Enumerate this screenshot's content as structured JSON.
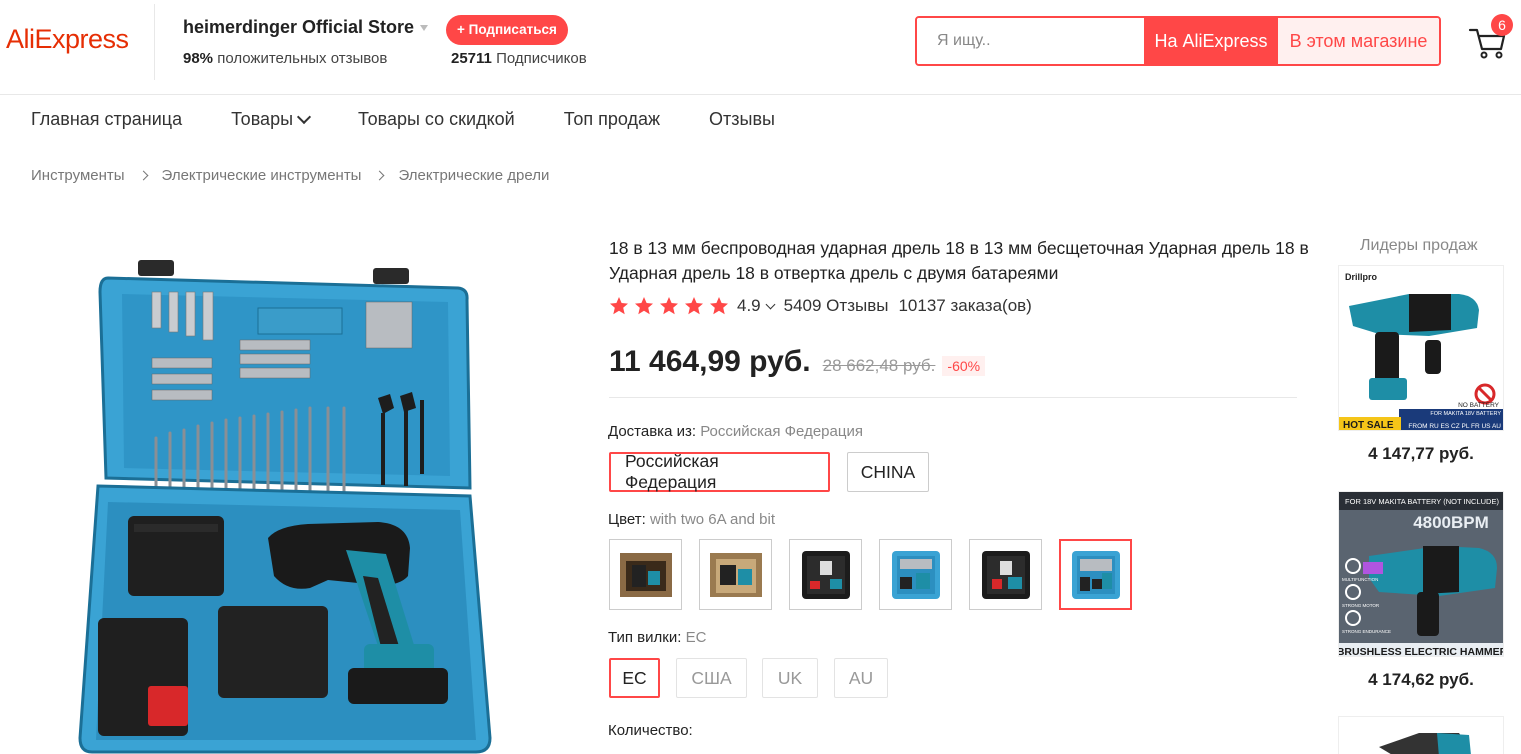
{
  "header": {
    "logo": "AliExpress",
    "store_name": "heimerdinger Official Store",
    "positive_pct": "98%",
    "positive_text": "положительных отзывов",
    "subscribe_label": "+ Подписаться",
    "followers_count": "25711",
    "followers_text": "Подписчиков",
    "search_placeholder": "Я ищу..",
    "search_aliexpress": "На AliExpress",
    "search_store": "В этом магазине",
    "cart_count": "6"
  },
  "nav": {
    "items": [
      "Главная страница",
      "Товары",
      "Товары со скидкой",
      "Топ продаж",
      "Отзывы"
    ]
  },
  "breadcrumb": [
    "Инструменты",
    "Электрические инструменты",
    "Электрические дрели"
  ],
  "product": {
    "title": "18 в 13 мм беспроводная ударная дрель 18 в 13 мм бесщеточная Ударная дрель 18 в Ударная дрель 18 в отвертка дрель с двумя батареями",
    "rating": "4.9",
    "stars": 5,
    "reviews": "5409 Отзывы",
    "orders": "10137 заказа(ов)",
    "price": "11 464,99 руб.",
    "old_price": "28 662,48 руб.",
    "discount": "-60%",
    "ship_label": "Доставка из:",
    "ship_value": "Российская Федерация",
    "ship_options": [
      "Российская Федерация",
      "CHINA"
    ],
    "color_label": "Цвет:",
    "color_value": "with two 6A and bit",
    "color_thumb_count": 6,
    "plug_label": "Тип вилки:",
    "plug_value": "EC",
    "plug_options": [
      "EC",
      "США",
      "UK",
      "AU"
    ],
    "quantity_label": "Количество:"
  },
  "sidebar": {
    "title": "Лидеры продаж",
    "items": [
      {
        "price": "4 147,77 руб.",
        "brand": "Drillpro",
        "line1": "NO BATTERY",
        "line2": "FOR MAKITA 18V BATTERY",
        "banner": "HOT SALE",
        "banner2": "FROM RU ES CZ PL FR US AU"
      },
      {
        "price": "4 174,62 руб.",
        "top": "FOR 18V MAKITA BATTERY (NOT INCLUDE)",
        "big": "4800BPM",
        "f1": "MULTIFUNCTION",
        "f2": "STRONG MOTOR",
        "f3": "STRONG ENDURANCE",
        "banner": "BRUSHLESS ELECTRIC HAMMER"
      }
    ]
  },
  "colors": {
    "accent": "#ff4747",
    "logo": "#e62e04",
    "case_blue": "#3aa3d4",
    "tool_teal": "#1e8ea6"
  }
}
